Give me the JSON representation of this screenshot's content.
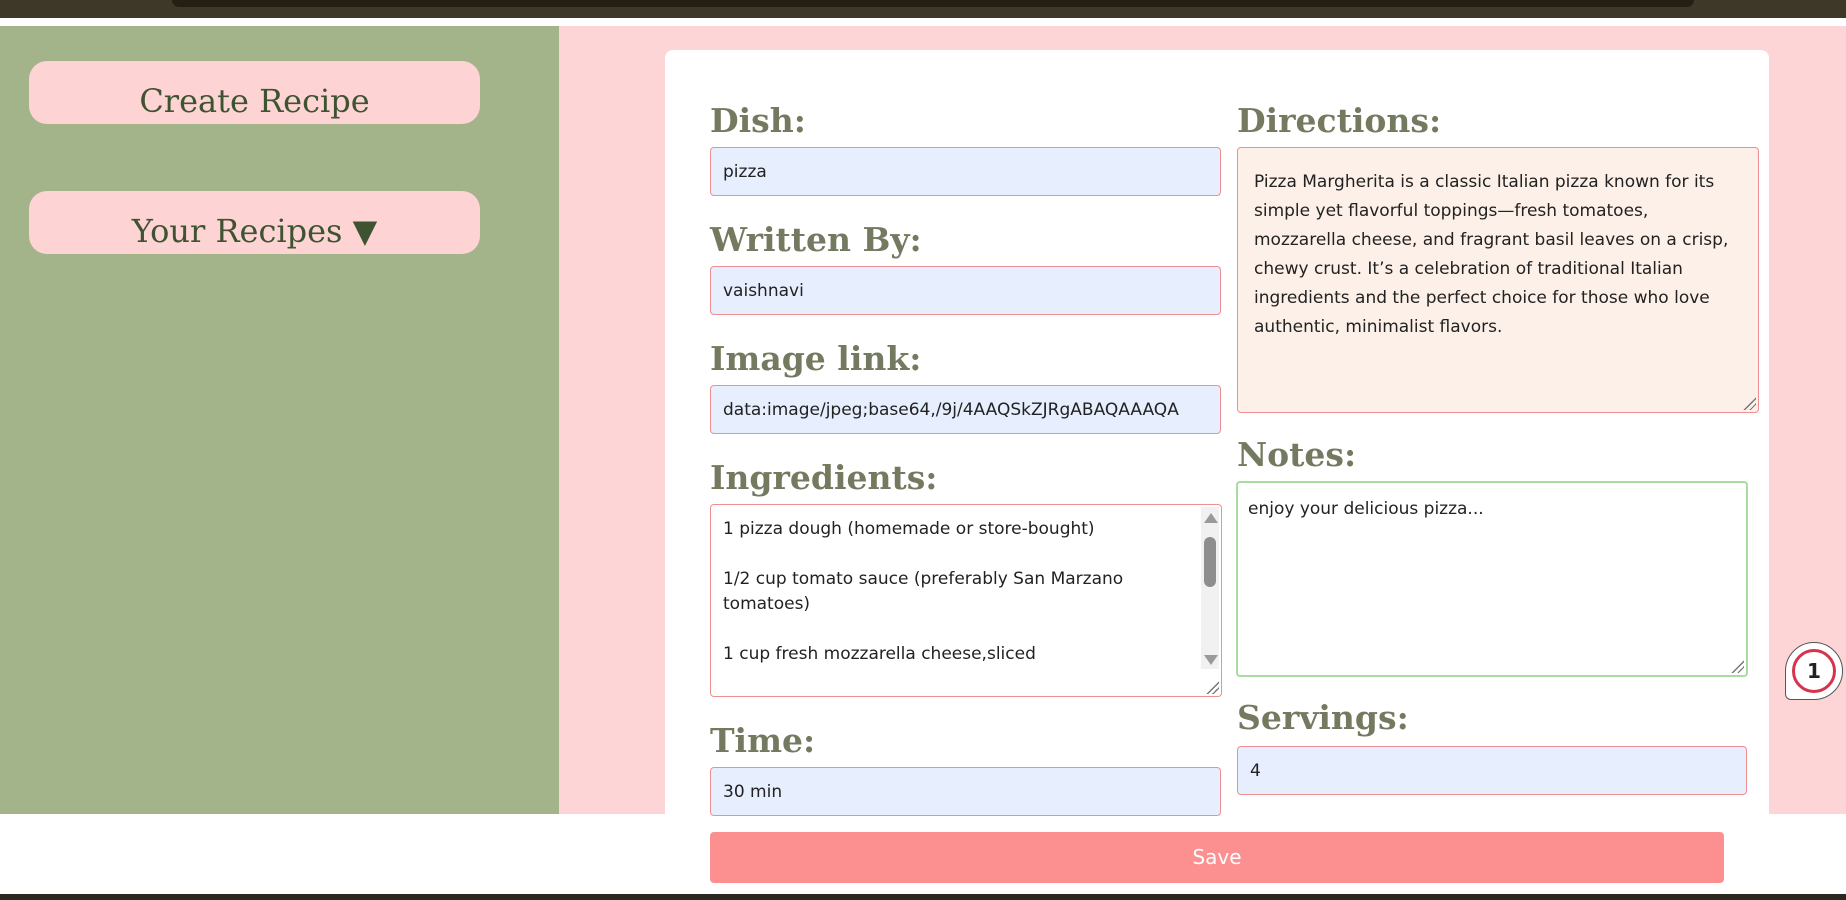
{
  "sidebar": {
    "create_label": "Create Recipe",
    "recipes_label": "Your Recipes ▼"
  },
  "form": {
    "dish_label": "Dish:",
    "dish_value": "pizza",
    "written_by_label": "Written By:",
    "written_by_value": "vaishnavi",
    "image_link_label": "Image link:",
    "image_link_value": "data:image/jpeg;base64,/9j/4AAQSkZJRgABAQAAAQA",
    "ingredients_label": "Ingredients:",
    "ingredients": [
      "1 pizza dough (homemade or store-bought)",
      "1/2 cup tomato sauce (preferably San Marzano tomatoes)",
      "1 cup fresh mozzarella cheese,sliced"
    ],
    "time_label": "Time:",
    "time_value": "30 min",
    "directions_label": "Directions:",
    "directions_value": "Pizza Margherita is a classic Italian pizza known for its simple yet flavorful toppings—fresh tomatoes, mozzarella cheese, and fragrant basil leaves on a crisp, chewy crust. It’s a celebration of traditional Italian ingredients and the perfect choice for those who love authentic, minimalist flavors.",
    "notes_label": "Notes:",
    "notes_value": "enjoy your delicious pizza...",
    "servings_label": "Servings:",
    "servings_value": "4",
    "save_label": "Save"
  },
  "badge": {
    "count": "1"
  },
  "colors": {
    "sidebar_bg": "#a4b48a",
    "main_bg": "#fdd5d6",
    "button_bg": "#fdd3d3",
    "label_color": "#747a5f",
    "save_bg": "#fc8f8f"
  }
}
